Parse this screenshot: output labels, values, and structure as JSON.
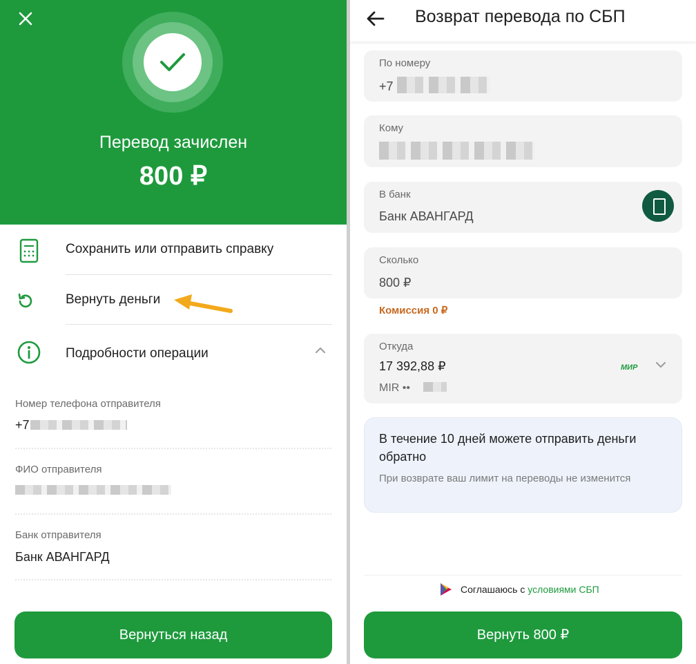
{
  "left": {
    "header": {
      "title": "Перевод зачислен",
      "amount": "800 ₽"
    },
    "actions": [
      {
        "label": "Сохранить или отправить справку",
        "icon": "receipt-icon"
      },
      {
        "label": "Вернуть деньги",
        "icon": "refresh-icon"
      },
      {
        "label": "Подробности операции",
        "icon": "info-icon"
      }
    ],
    "details": [
      {
        "label": "Номер телефона отправителя",
        "value": "+7"
      },
      {
        "label": "ФИО отправителя",
        "value": ""
      },
      {
        "label": "Банк отправителя",
        "value": "Банк АВАНГАРД"
      }
    ],
    "back_button": "Вернуться назад"
  },
  "right": {
    "topbar": {
      "title": "Возврат перевода по СБП"
    },
    "fields": {
      "phone": {
        "label": "По номеру",
        "value": "+7"
      },
      "recipient": {
        "label": "Кому",
        "value": ""
      },
      "bank": {
        "label": "В банк",
        "value": "Банк АВАНГАРД"
      },
      "amount": {
        "label": "Сколько",
        "value": "800 ₽"
      },
      "commission": "Комиссия 0 ₽",
      "source": {
        "label": "Откуда",
        "balance": "17 392,88 ₽",
        "card": "MIR ••",
        "card_brand": "МИР"
      }
    },
    "info": {
      "title": "В течение 10 дней можете отправить деньги обратно",
      "text": "При возврате ваш лимит на переводы не изменится"
    },
    "agree": {
      "text": "Соглашаюсь с ",
      "link": "условиями СБП"
    },
    "submit_button": "Вернуть 800 ₽"
  },
  "colors": {
    "brand_green": "#1e9a3d",
    "commission_orange": "#c7691f",
    "arrow_yellow": "#f2a91c"
  }
}
